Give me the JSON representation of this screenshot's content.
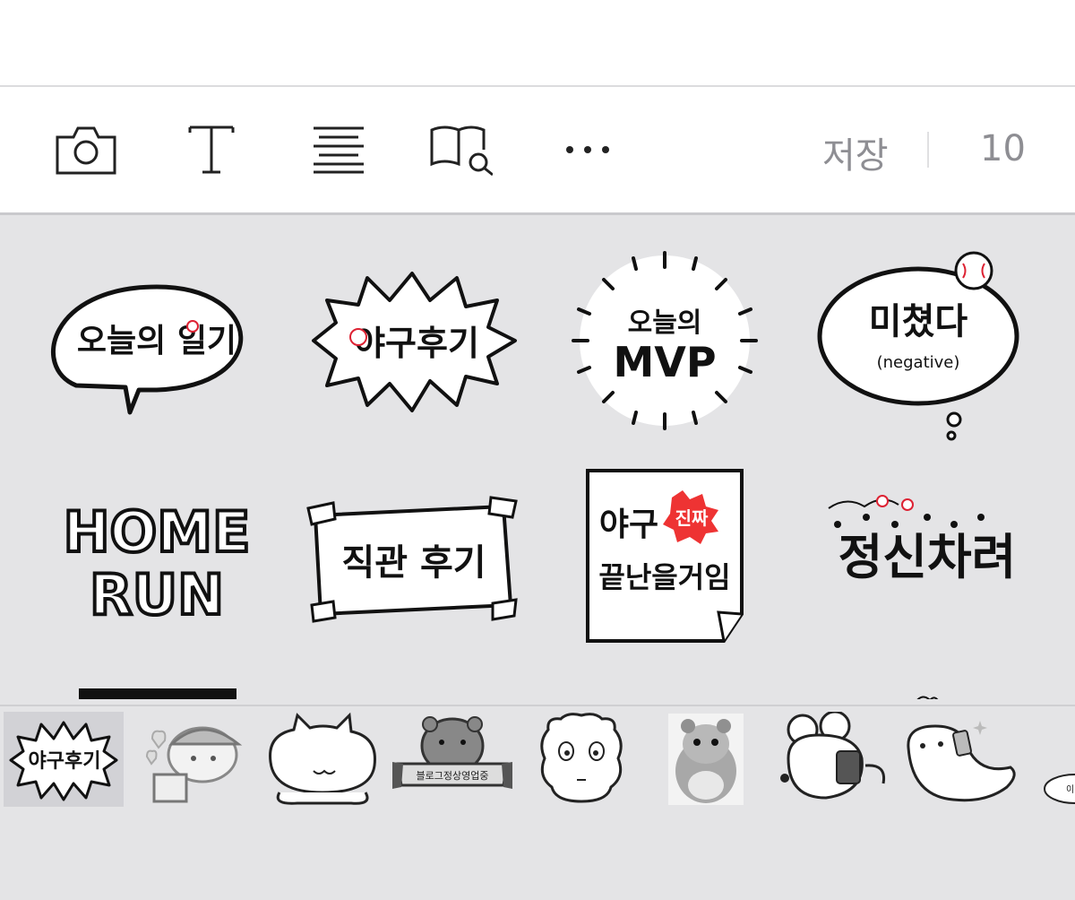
{
  "toolbar": {
    "icons": [
      "camera-icon",
      "text-icon",
      "align-icon",
      "book-search-icon",
      "more-icon"
    ],
    "save_label": "저장",
    "count": "10"
  },
  "stickers": [
    {
      "name": "sticker-today-diary",
      "text": "오늘의 일기"
    },
    {
      "name": "sticker-baseball-review",
      "text": "야구후기"
    },
    {
      "name": "sticker-today-mvp",
      "line1": "오늘의",
      "line2": "MVP"
    },
    {
      "name": "sticker-crazy-negative",
      "line1": "미쳤다",
      "line2": "(negative)"
    },
    {
      "name": "sticker-home-run",
      "line1": "HOME",
      "line2": "RUN"
    },
    {
      "name": "sticker-stadium-review",
      "text": "직관 후기"
    },
    {
      "name": "sticker-baseball-not-over",
      "line1": "야구",
      "tag": "진짜",
      "line2": "끝난을거임"
    },
    {
      "name": "sticker-get-it-together",
      "text": "정신차려"
    }
  ],
  "packs": [
    {
      "name": "pack-baseball-review",
      "label": "야구후기",
      "selected": true
    },
    {
      "name": "pack-hearts-character",
      "selected": false
    },
    {
      "name": "pack-cat-blob",
      "selected": false
    },
    {
      "name": "pack-otter-banner",
      "banner": "블로그정상영업중",
      "selected": false
    },
    {
      "name": "pack-fluffy-face",
      "selected": false
    },
    {
      "name": "pack-hamster-photo",
      "selected": false
    },
    {
      "name": "pack-mouse-phone",
      "selected": false
    },
    {
      "name": "pack-seal-phone",
      "selected": false
    },
    {
      "name": "pack-partial",
      "label": "이번",
      "selected": false
    }
  ]
}
